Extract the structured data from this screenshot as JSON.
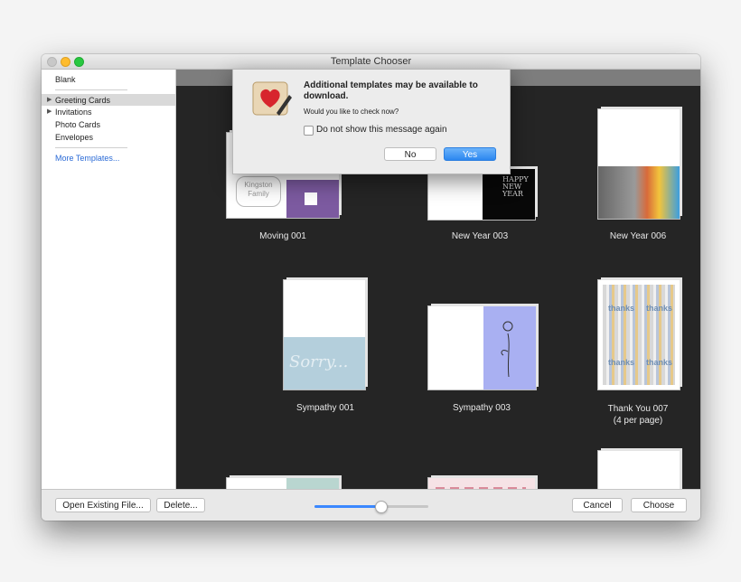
{
  "window": {
    "title": "Template Chooser"
  },
  "sidebar": {
    "blank": "Blank",
    "categories": [
      "Greeting Cards",
      "Invitations",
      "Photo Cards",
      "Envelopes"
    ],
    "more": "More Templates..."
  },
  "templates": [
    {
      "label": "Moving 001"
    },
    {
      "label": "New Year 003"
    },
    {
      "label": "New Year 006"
    },
    {
      "label": "Sympathy 001"
    },
    {
      "label": "Sympathy 003"
    },
    {
      "label": "Thank You 007",
      "sublabel": "(4 per page)"
    }
  ],
  "card_text": {
    "kingston": "Kingston",
    "family": "Family",
    "happy": "HAPPY",
    "new": "NEW",
    "year": "YEAR",
    "sorry": "Sorry...",
    "thanks": "thanks"
  },
  "bottom": {
    "open": "Open Existing File...",
    "delete": "Delete...",
    "cancel": "Cancel",
    "choose": "Choose",
    "zoom_level": 0.58
  },
  "dialog": {
    "title": "Additional templates may be available to download.",
    "message": "Would you like to check now?",
    "checkbox_label": "Do not show this message again",
    "checkbox_checked": false,
    "no": "No",
    "yes": "Yes"
  }
}
